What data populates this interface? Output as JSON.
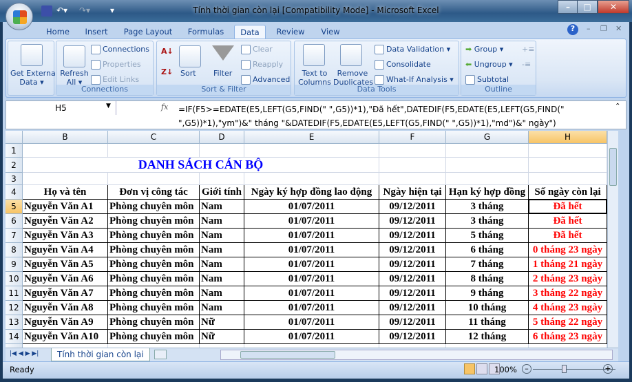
{
  "window": {
    "title": "Tính thời gian còn lại  [Compatibility Mode] - Microsoft Excel"
  },
  "ribbon_tabs": [
    "Home",
    "Insert",
    "Page Layout",
    "Formulas",
    "Data",
    "Review",
    "View"
  ],
  "active_tab": "Data",
  "ribbon": {
    "get_external": {
      "label1": "Get External",
      "label2": "Data ▾"
    },
    "connections_group": {
      "label": "Connections",
      "refresh1": "Refresh",
      "refresh2": "All ▾",
      "connections": "Connections",
      "properties": "Properties",
      "edit_links": "Edit Links"
    },
    "sort_group": {
      "label": "Sort & Filter",
      "sort": "Sort",
      "filter": "Filter",
      "clear": "Clear",
      "reapply": "Reapply",
      "advanced": "Advanced"
    },
    "tools_group": {
      "label": "Data Tools",
      "text1": "Text to",
      "text2": "Columns",
      "remove1": "Remove",
      "remove2": "Duplicates",
      "validation": "Data Validation ▾",
      "consolidate": "Consolidate",
      "whatif": "What-If Analysis ▾"
    },
    "outline_group": {
      "label": "Outline",
      "group": "Group ▾",
      "ungroup": "Ungroup ▾",
      "subtotal": "Subtotal"
    }
  },
  "formula_bar": {
    "name_box": "H5",
    "fx": "fx",
    "formula": "=IF(F5>=EDATE(E5,LEFT(G5,FIND(\" \",G5))*1),\"Đã hết\",DATEDIF(F5,EDATE(E5,LEFT(G5,FIND(\" \",G5))*1),\"ym\")&\" tháng \"&DATEDIF(F5,EDATE(E5,LEFT(G5,FIND(\" \",G5))*1),\"md\")&\" ngày\")"
  },
  "columns": [
    "B",
    "C",
    "D",
    "E",
    "F",
    "G",
    "H"
  ],
  "row_numbers": [
    "1",
    "2",
    "3",
    "4",
    "5",
    "6",
    "7",
    "8",
    "9",
    "10",
    "11",
    "12",
    "13",
    "14",
    "15"
  ],
  "sheet_title": "DANH SÁCH CÁN BỘ",
  "headers": [
    "Họ và tên",
    "Đơn vị công tác",
    "Giới tính",
    "Ngày ký hợp đồng lao động",
    "Ngày hiện tại",
    "Hạn ký hợp đồng",
    "Số ngày còn lại"
  ],
  "rows": [
    [
      "Nguyễn Văn A1",
      "Phòng chuyên môn",
      "Nam",
      "01/07/2011",
      "09/12/2011",
      "3 tháng",
      "Đã hết"
    ],
    [
      "Nguyễn Văn A2",
      "Phòng chuyên môn",
      "Nam",
      "01/07/2011",
      "09/12/2011",
      "3 tháng",
      "Đã hết"
    ],
    [
      "Nguyễn Văn A3",
      "Phòng chuyên môn",
      "Nam",
      "01/07/2011",
      "09/12/2011",
      "5 tháng",
      "Đã hết"
    ],
    [
      "Nguyễn Văn A4",
      "Phòng chuyên môn",
      "Nam",
      "01/07/2011",
      "09/12/2011",
      "6 tháng",
      "0 tháng 23 ngày"
    ],
    [
      "Nguyễn Văn A5",
      "Phòng chuyên môn",
      "Nam",
      "01/07/2011",
      "09/12/2011",
      "7 tháng",
      "1 tháng 21 ngày"
    ],
    [
      "Nguyễn Văn A6",
      "Phòng chuyên môn",
      "Nam",
      "01/07/2011",
      "09/12/2011",
      "8 tháng",
      "2 tháng 23 ngày"
    ],
    [
      "Nguyễn Văn A7",
      "Phòng chuyên môn",
      "Nam",
      "01/07/2011",
      "09/12/2011",
      "9 tháng",
      "3 tháng 22 ngày"
    ],
    [
      "Nguyễn Văn A8",
      "Phòng chuyên môn",
      "Nam",
      "01/07/2011",
      "09/12/2011",
      "10 tháng",
      "4 tháng 23 ngày"
    ],
    [
      "Nguyễn Văn A9",
      "Phòng chuyên môn",
      "Nữ",
      "01/07/2011",
      "09/12/2011",
      "11 tháng",
      "5 tháng 22 ngày"
    ],
    [
      "Nguyễn Văn A10",
      "Phòng chuyên môn",
      "Nữ",
      "01/07/2011",
      "09/12/2011",
      "12 tháng",
      "6 tháng 23 ngày"
    ]
  ],
  "selected_cell": "H5",
  "sheet_tab": "Tính thời gian còn lại",
  "status": {
    "ready": "Ready",
    "zoom": "100%"
  },
  "colors": {
    "title": "#0000ff",
    "result": "#ff0000",
    "selected_header": "#f7c466"
  }
}
